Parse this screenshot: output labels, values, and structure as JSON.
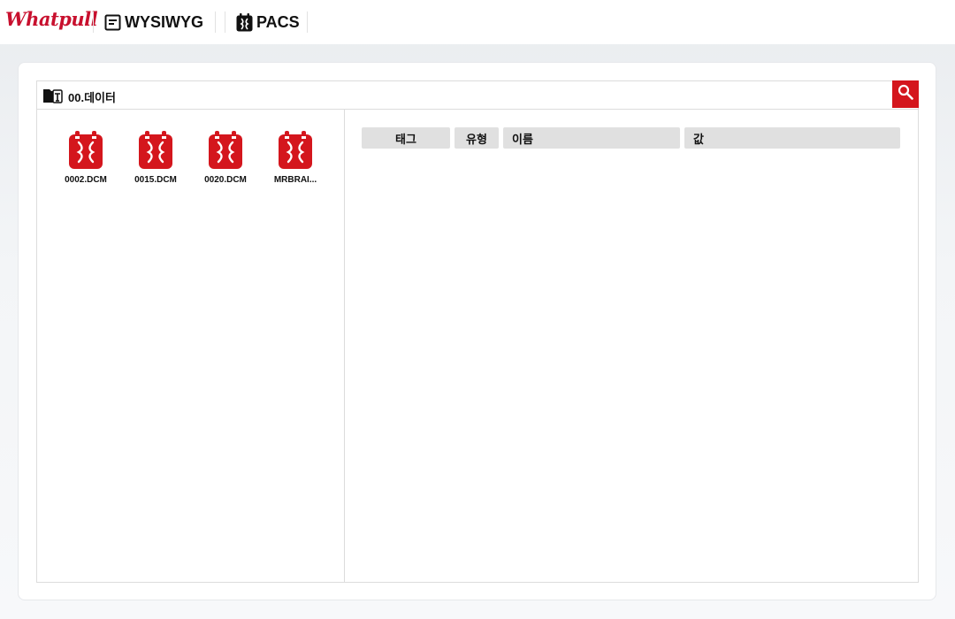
{
  "header": {
    "logo": "Whatpull",
    "nav": [
      {
        "label": "WYSIWYG",
        "icon": "document-icon"
      },
      {
        "label": "PACS",
        "icon": "pacs-icon"
      }
    ]
  },
  "path": {
    "label": "00.데이터",
    "icon": "folder-icon",
    "search_icon": "search-icon"
  },
  "files": [
    {
      "name": "0002.DCM",
      "icon": "dicom-file-icon"
    },
    {
      "name": "0015.DCM",
      "icon": "dicom-file-icon"
    },
    {
      "name": "0020.DCM",
      "icon": "dicom-file-icon"
    },
    {
      "name": "MRBRAI...",
      "icon": "dicom-file-icon"
    }
  ],
  "table": {
    "columns": [
      "태그",
      "유형",
      "이름",
      "값"
    ]
  },
  "colors": {
    "accent": "#d4161d",
    "logo": "#c8102e",
    "header_cell_bg": "#e0e0e0"
  }
}
